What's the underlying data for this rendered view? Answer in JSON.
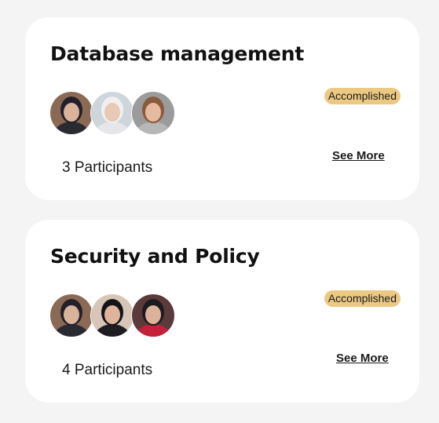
{
  "projects": [
    {
      "title": "Database management",
      "status": "Accomplished",
      "participants": "3 Participants",
      "see_more": "See More",
      "avatars": [
        {
          "name": "participant-avatar-1",
          "bg": "#8a6a55",
          "skin": "#d9b49b",
          "cloth": "#2a2a33",
          "hair": "#23202a"
        },
        {
          "name": "participant-avatar-2",
          "bg": "#cfd6db",
          "skin": "#e9c8b6",
          "cloth": "#e5e5ea",
          "hair": "#f0f0f2"
        },
        {
          "name": "participant-avatar-3",
          "bg": "#9b9b9b",
          "skin": "#e6b9a1",
          "cloth": "#b7b7b7",
          "hair": "#8a5a3c"
        }
      ]
    },
    {
      "title": "Security and Policy",
      "status": "Accomplished",
      "participants": "4 Participants",
      "see_more": "See More",
      "avatars": [
        {
          "name": "participant-avatar-1",
          "bg": "#8a6a55",
          "skin": "#d9b49b",
          "cloth": "#2a2a33",
          "hair": "#23202a"
        },
        {
          "name": "participant-avatar-2",
          "bg": "#d7c5b8",
          "skin": "#e0b49b",
          "cloth": "#1d1d22",
          "hair": "#141418"
        },
        {
          "name": "participant-avatar-3",
          "bg": "#5a3a3a",
          "skin": "#ddb29a",
          "cloth": "#c4223a",
          "hair": "#1b1b1f"
        }
      ]
    }
  ]
}
